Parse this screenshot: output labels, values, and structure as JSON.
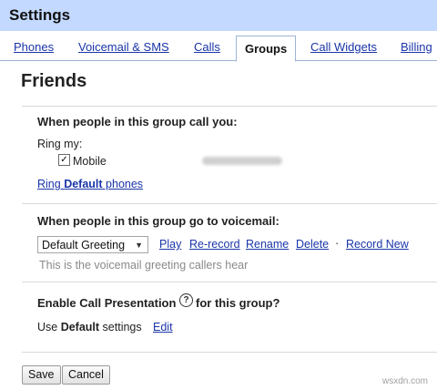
{
  "header": {
    "title": "Settings"
  },
  "tabs": [
    {
      "label": "Phones"
    },
    {
      "label": "Voicemail & SMS"
    },
    {
      "label": "Calls"
    },
    {
      "label": "Groups",
      "active": true
    },
    {
      "label": "Call Widgets"
    },
    {
      "label": "Billing"
    }
  ],
  "page": {
    "title": "Friends"
  },
  "call_section": {
    "title": "When people in this group call you:",
    "ring_label": "Ring my:",
    "mobile_label": "Mobile",
    "mobile_checked": true,
    "ring_default_prefix": "Ring ",
    "ring_default_bold": "Default",
    "ring_default_suffix": " phones"
  },
  "voicemail_section": {
    "title": "When people in this group go to voicemail:",
    "greeting_value": "Default Greeting",
    "actions": [
      "Play",
      "Re-record",
      "Rename",
      "Delete"
    ],
    "separator": "·",
    "record_new": "Record New",
    "hint": "This is the voicemail greeting callers hear"
  },
  "presentation_section": {
    "title_prefix": "Enable Call Presentation",
    "title_suffix": "for this group?",
    "help_icon_glyph": "?",
    "use_prefix": "Use ",
    "use_bold": "Default",
    "use_suffix": " settings",
    "edit_label": "Edit"
  },
  "buttons": {
    "save": "Save",
    "cancel": "Cancel"
  },
  "watermark": "wsxdn.com",
  "colors": {
    "header_bg": "#c3d9ff",
    "link": "#1a35a8"
  }
}
